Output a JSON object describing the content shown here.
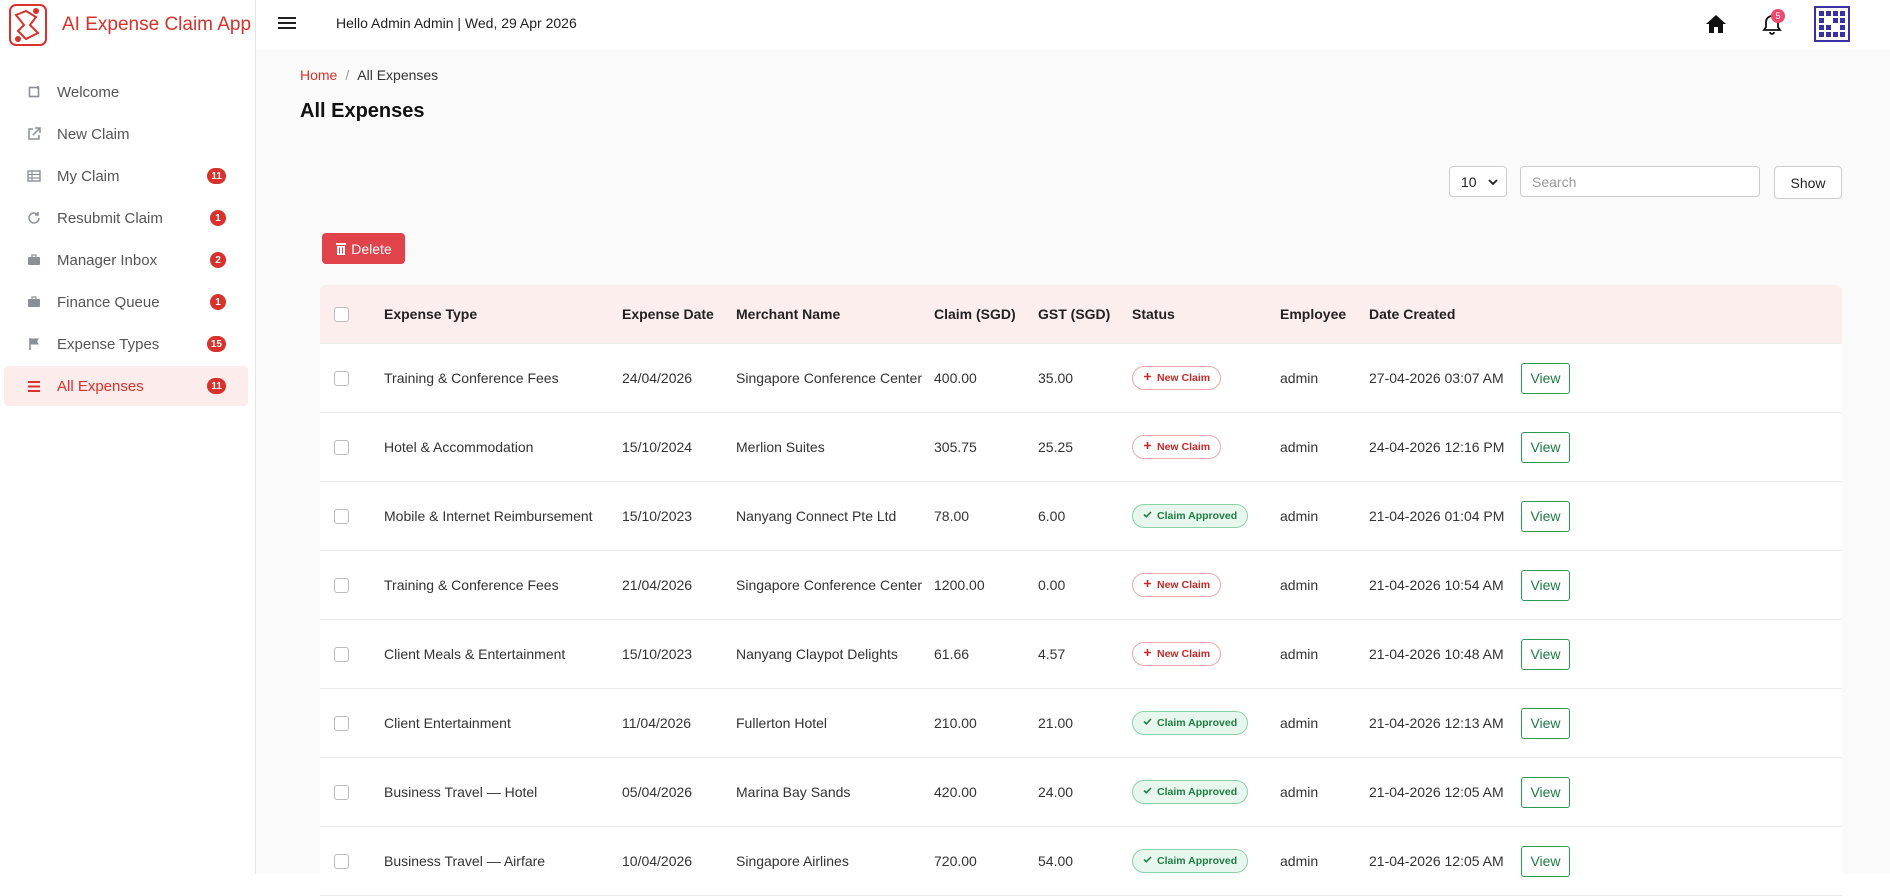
{
  "app": {
    "name": "AI Expense Claim App",
    "greeting": "Hello Admin Admin | Wed, 29 Apr 2026",
    "notification_count": "5"
  },
  "sidebar": {
    "items": [
      {
        "label": "Welcome",
        "icon": "square-icon",
        "badge": ""
      },
      {
        "label": "New Claim",
        "icon": "external-link-icon",
        "badge": ""
      },
      {
        "label": "My Claim",
        "icon": "table-icon",
        "badge": "11"
      },
      {
        "label": "Resubmit Claim",
        "icon": "refresh-icon",
        "badge": "1"
      },
      {
        "label": "Manager Inbox",
        "icon": "briefcase-icon",
        "badge": "2"
      },
      {
        "label": "Finance Queue",
        "icon": "briefcase-icon",
        "badge": "1"
      },
      {
        "label": "Expense Types",
        "icon": "flag-icon",
        "badge": "15"
      },
      {
        "label": "All Expenses",
        "icon": "list-icon",
        "badge": "11",
        "active": true
      }
    ]
  },
  "breadcrumb": {
    "home": "Home",
    "separator": "/",
    "current": "All Expenses"
  },
  "page": {
    "title": "All Expenses"
  },
  "controls": {
    "page_size": "10",
    "search_placeholder": "Search",
    "show_label": "Show",
    "delete_label": "Delete"
  },
  "table": {
    "headers": [
      "Expense Type",
      "Expense Date",
      "Merchant Name",
      "Claim (SGD)",
      "GST (SGD)",
      "Status",
      "Employee",
      "Date Created"
    ],
    "view_label": "View",
    "rows": [
      {
        "type": "Training & Conference Fees",
        "date": "24/04/2026",
        "merchant": "Singapore Conference Center",
        "claim": "400.00",
        "gst": "35.00",
        "status": "New Claim",
        "status_kind": "new",
        "employee": "admin",
        "created": "27-04-2026 03:07 AM"
      },
      {
        "type": "Hotel & Accommodation",
        "date": "15/10/2024",
        "merchant": "Merlion Suites",
        "claim": "305.75",
        "gst": "25.25",
        "status": "New Claim",
        "status_kind": "new",
        "employee": "admin",
        "created": "24-04-2026 12:16 PM"
      },
      {
        "type": "Mobile & Internet Reimbursement",
        "date": "15/10/2023",
        "merchant": "Nanyang Connect Pte Ltd",
        "claim": "78.00",
        "gst": "6.00",
        "status": "Claim Approved",
        "status_kind": "approved",
        "employee": "admin",
        "created": "21-04-2026 01:04 PM"
      },
      {
        "type": "Training & Conference Fees",
        "date": "21/04/2026",
        "merchant": "Singapore Conference Center",
        "claim": "1200.00",
        "gst": "0.00",
        "status": "New Claim",
        "status_kind": "new",
        "employee": "admin",
        "created": "21-04-2026 10:54 AM"
      },
      {
        "type": "Client Meals & Entertainment",
        "date": "15/10/2023",
        "merchant": "Nanyang Claypot Delights",
        "claim": "61.66",
        "gst": "4.57",
        "status": "New Claim",
        "status_kind": "new",
        "employee": "admin",
        "created": "21-04-2026 10:48 AM"
      },
      {
        "type": "Client Entertainment",
        "date": "11/04/2026",
        "merchant": "Fullerton Hotel",
        "claim": "210.00",
        "gst": "21.00",
        "status": "Claim Approved",
        "status_kind": "approved",
        "employee": "admin",
        "created": "21-04-2026 12:13 AM"
      },
      {
        "type": "Business Travel — Hotel",
        "date": "05/04/2026",
        "merchant": "Marina Bay Sands",
        "claim": "420.00",
        "gst": "24.00",
        "status": "Claim Approved",
        "status_kind": "approved",
        "employee": "admin",
        "created": "21-04-2026 12:05 AM"
      },
      {
        "type": "Business Travel — Airfare",
        "date": "10/04/2026",
        "merchant": "Singapore Airlines",
        "claim": "720.00",
        "gst": "54.00",
        "status": "Claim Approved",
        "status_kind": "approved",
        "employee": "admin",
        "created": "21-04-2026 12:05 AM"
      }
    ]
  },
  "colors": {
    "brand": "#d9312b",
    "approved": "#1e7d44",
    "badge": "#d9312b"
  }
}
